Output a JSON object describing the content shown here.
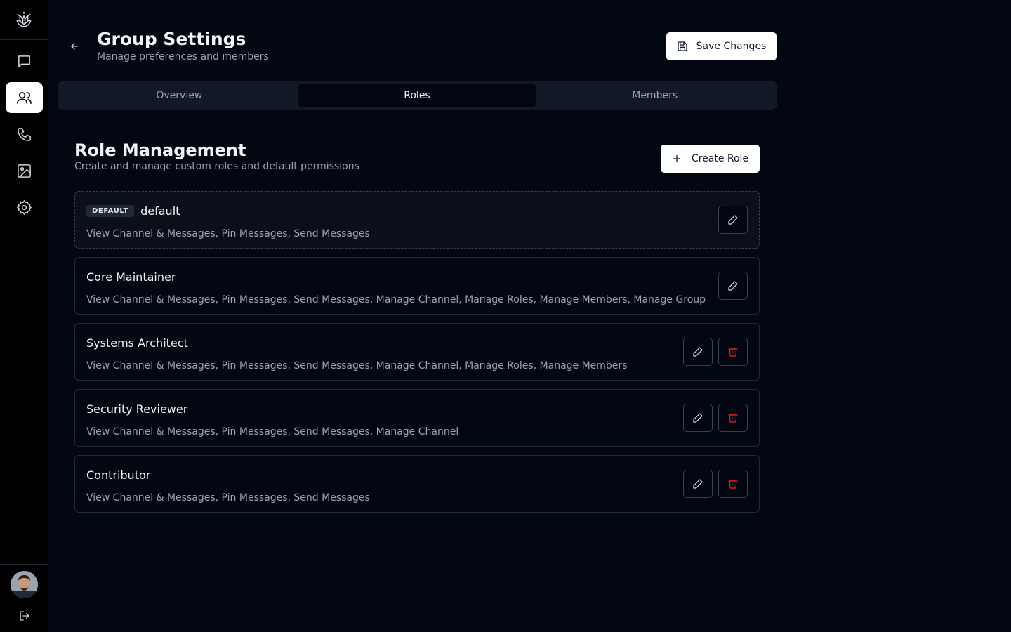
{
  "sidebar": {
    "logo_icon": "lotus-logo-icon",
    "items": [
      {
        "name": "messages",
        "icon": "chat-icon",
        "active": false
      },
      {
        "name": "groups",
        "icon": "users-icon",
        "active": true
      },
      {
        "name": "calls",
        "icon": "phone-icon",
        "active": false
      },
      {
        "name": "media",
        "icon": "image-icon",
        "active": false
      },
      {
        "name": "settings",
        "icon": "gear-icon",
        "active": false
      }
    ],
    "logout_icon": "logout-icon"
  },
  "header": {
    "title": "Group Settings",
    "subtitle": "Manage preferences and members",
    "save_label": "Save Changes"
  },
  "tabs": [
    {
      "label": "Overview",
      "active": false
    },
    {
      "label": "Roles",
      "active": true
    },
    {
      "label": "Members",
      "active": false
    }
  ],
  "section": {
    "title": "Role Management",
    "subtitle": "Create and manage custom roles and default permissions",
    "create_label": "Create Role"
  },
  "roles": [
    {
      "badge": "DEFAULT",
      "name": "default",
      "permissions": "View Channel & Messages, Pin Messages, Send Messages",
      "deletable": false
    },
    {
      "name": "Core Maintainer",
      "permissions": "View Channel & Messages, Pin Messages, Send Messages, Manage Channel, Manage Roles, Manage Members, Manage Group",
      "deletable": false
    },
    {
      "name": "Systems Architect",
      "permissions": "View Channel & Messages, Pin Messages, Send Messages, Manage Channel, Manage Roles, Manage Members",
      "deletable": true
    },
    {
      "name": "Security Reviewer",
      "permissions": "View Channel & Messages, Pin Messages, Send Messages, Manage Channel",
      "deletable": true
    },
    {
      "name": "Contributor",
      "permissions": "View Channel & Messages, Pin Messages, Send Messages",
      "deletable": true
    }
  ],
  "colors": {
    "background": "#030712",
    "sidebar": "#000000",
    "delete": "#dc2626"
  }
}
